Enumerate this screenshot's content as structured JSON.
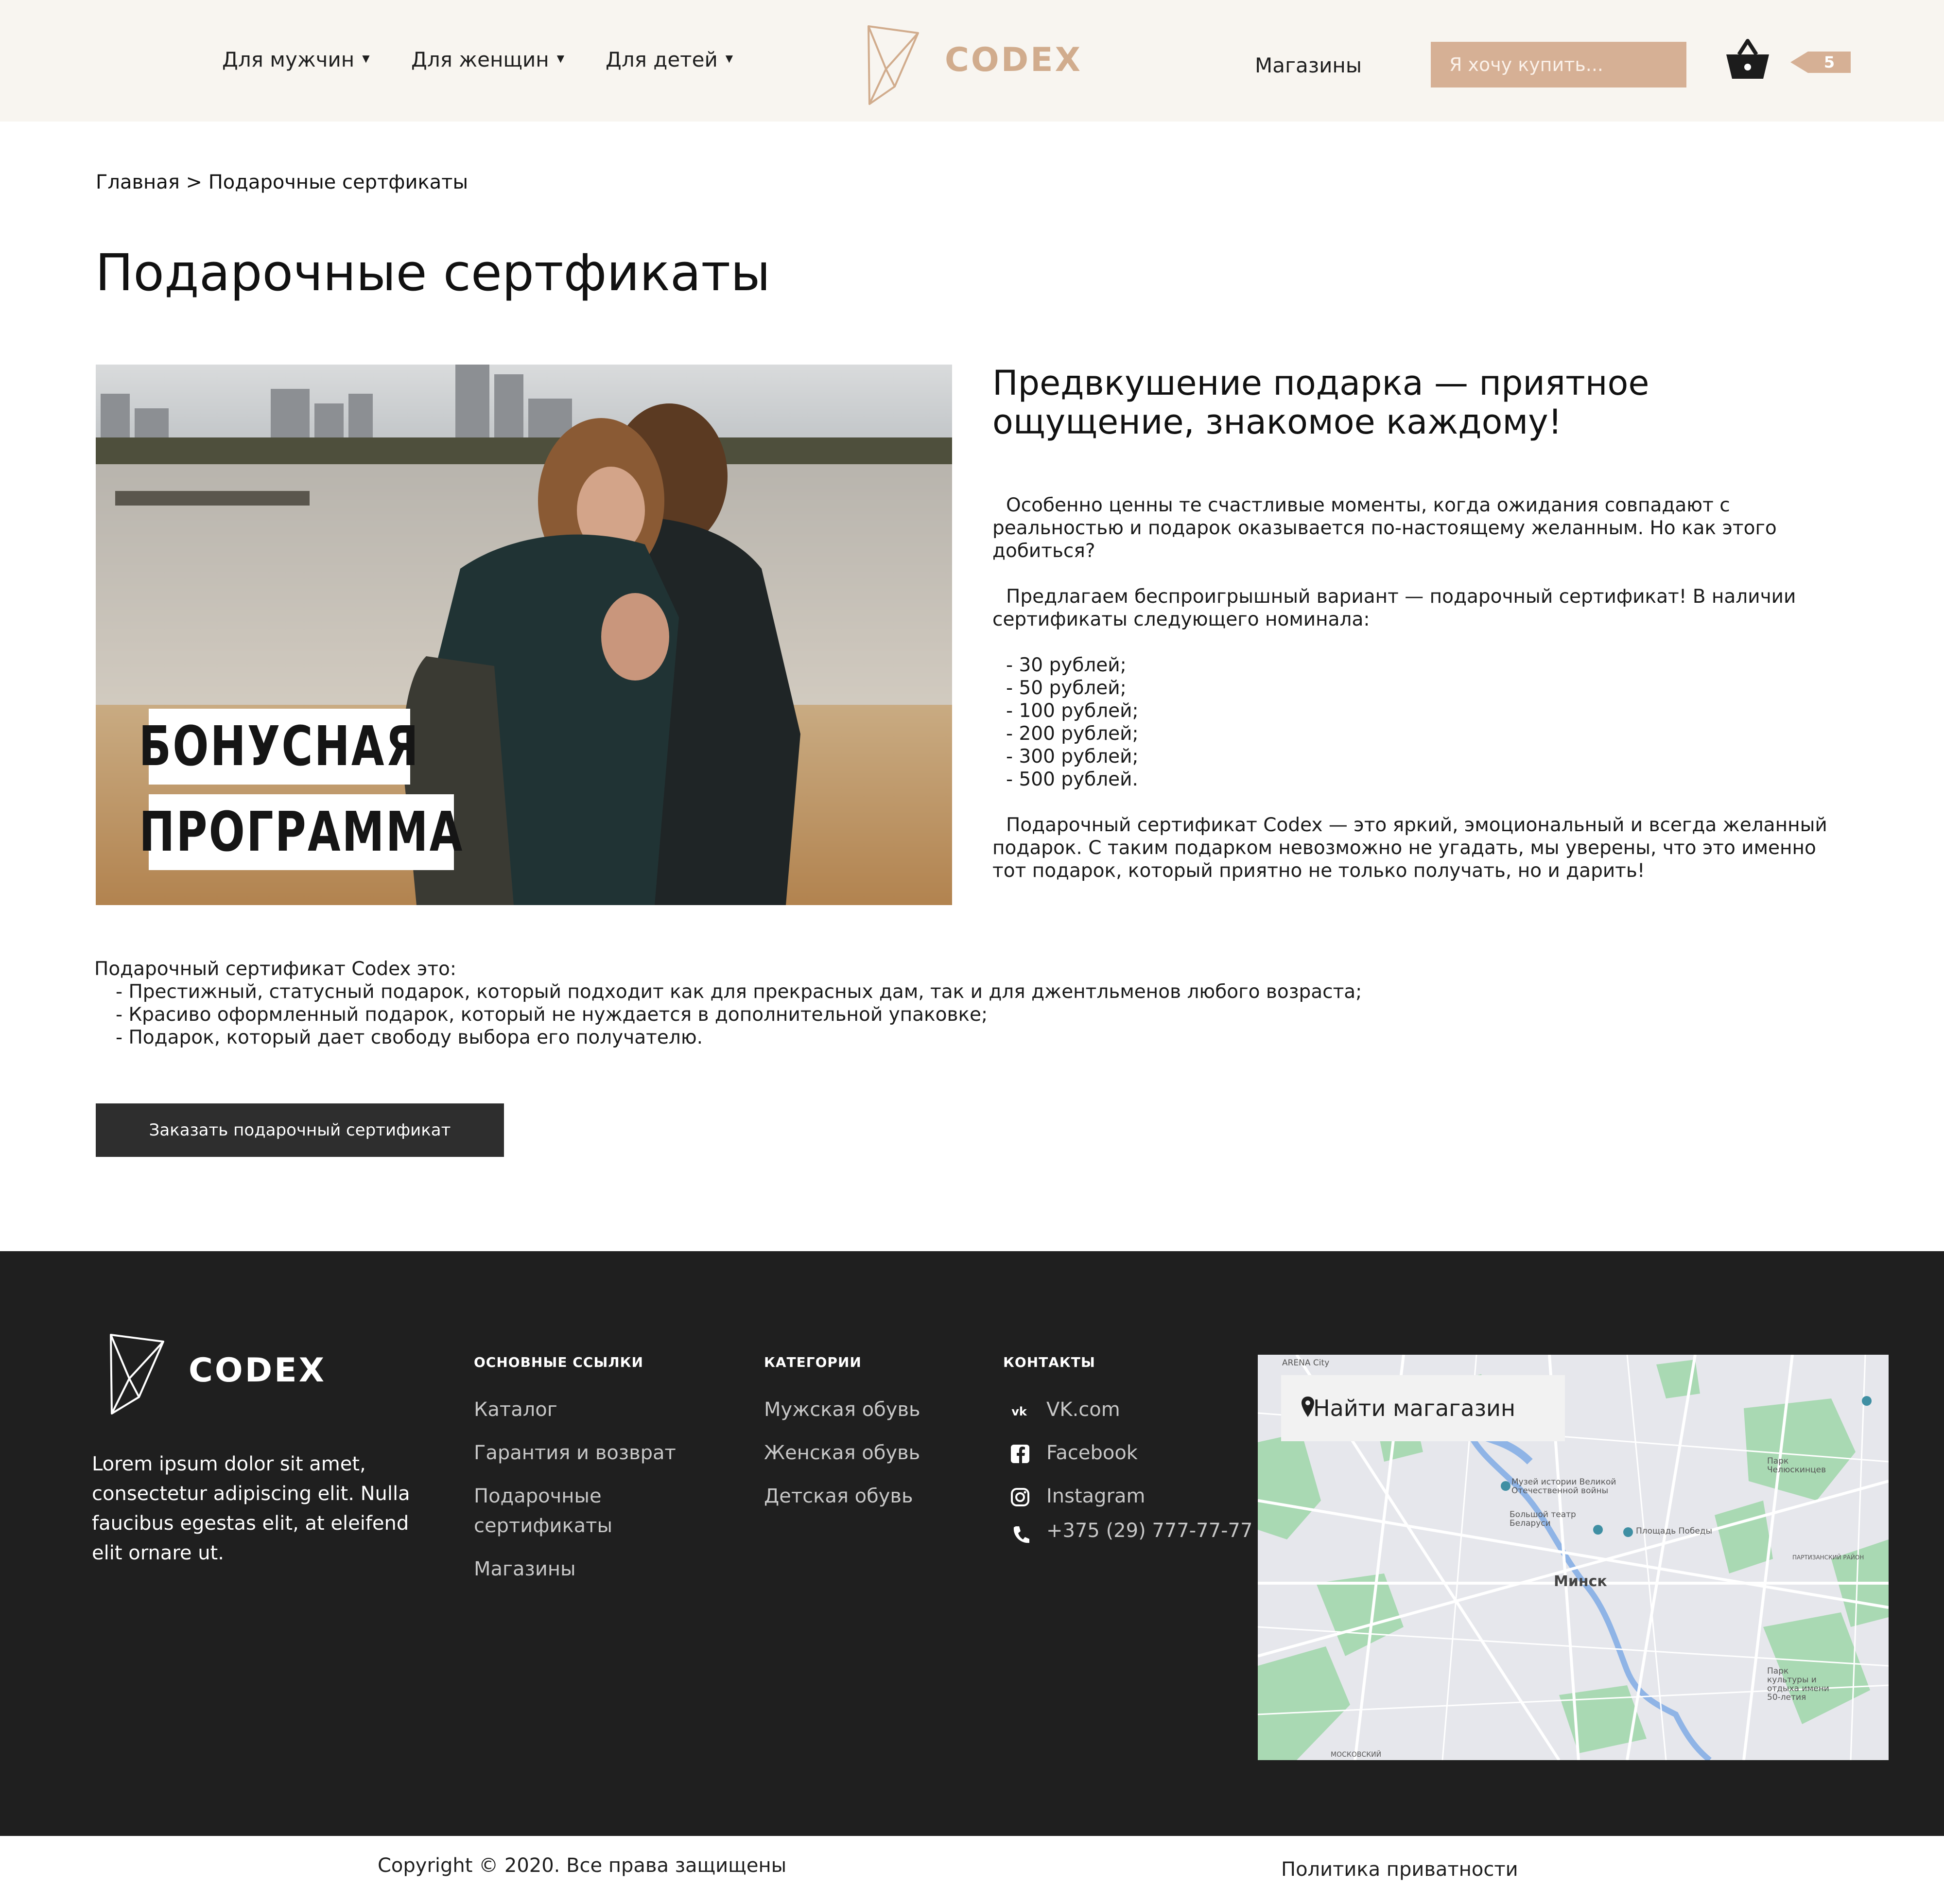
{
  "header": {
    "nav": [
      {
        "label": "Для мужчин"
      },
      {
        "label": "Для женщин"
      },
      {
        "label": "Для детей"
      }
    ],
    "logo_text": "CODEX",
    "stores_label": "Магазины",
    "search_placeholder": "Я хочу купить...",
    "cart_count": "5"
  },
  "breadcrumb": "Главная > Подарочные сертфикаты",
  "page_title": "Подарочные сертфикаты",
  "hero": {
    "promo_line1": "БОНУСНАЯ",
    "promo_line2": "ПРОГРАММА"
  },
  "intro": {
    "heading": "Предвкушение подарка — приятное ощущение, знакомое каждому!",
    "paragraph1": "Особенно ценны те счастливые моменты, когда ожидания совпадают с реальностью и подарок оказывается по-настоящему желанным. Но как этого добиться?",
    "paragraph2": "Предлагаем беспроигрышный вариант — подарочный сертификат! В наличии сертификаты следующего номинала:",
    "denominations": [
      "- 30 рублей;",
      "- 50 рублей;",
      "- 100 рублей;",
      "- 200 рублей;",
      "- 300 рублей;",
      "- 500 рублей."
    ],
    "paragraph3": "Подарочный сертификат Codex — это яркий, эмоциональный и всегда желанный подарок. С таким подарком невозможно не угадать, мы уверены, что это именно тот подарок, который приятно не только получать, но и дарить!"
  },
  "benefits": {
    "title": "Подарочный сертификат Codex это:",
    "items": [
      "- Престижный, статусный подарок, который подходит как для прекрасных дам, так и для джентльменов любого возраста;",
      "- Красиво оформленный подарок, который не нуждается в дополнительной упаковке;",
      "- Подарок, который дает свободу выбора его получателю."
    ]
  },
  "order_button": "Заказать подарочный сертификат",
  "footer": {
    "logo_text": "CODEX",
    "about": "Lorem ipsum dolor sit amet, consectetur adipiscing elit. Nulla faucibus egestas elit, at eleifend elit ornare ut.",
    "links_title": "ОСНОВНЫЕ ССЫЛКИ",
    "links": [
      "Каталог",
      "Гарантия и возврат",
      "Подарочные сертификаты",
      "Магазины"
    ],
    "categories_title": "КАТЕГОРИИ",
    "categories": [
      "Мужская обувь",
      "Женская обувь",
      "Детская обувь"
    ],
    "contacts_title": "КОНТАКТЫ",
    "contacts": [
      {
        "icon": "vk-icon",
        "label": "VK.com"
      },
      {
        "icon": "facebook-icon",
        "label": "Facebook"
      },
      {
        "icon": "instagram-icon",
        "label": "Instagram"
      },
      {
        "icon": "phone-icon",
        "label": "+375 (29) 777-77-77"
      }
    ],
    "map": {
      "search_label": "Найти магагазин",
      "city": "Минск",
      "labels": {
        "arena": "ARENA City",
        "museum": "Музей истории Великой Отечественной войны",
        "theatre": "Большой театр Беларуси",
        "square": "Площадь Победы",
        "park1": "Парк Челюскинцев",
        "partizan": "ПАРТИЗАНСКИЙ РАЙОН",
        "park2": "Парк культуры и отдыха имени 50-летия",
        "moskovsky": "МОСКОВСКИЙ"
      }
    }
  },
  "bottom": {
    "copyright": "Copyright © 2020. Все права защищены",
    "privacy": "Политика приватности"
  },
  "colors": {
    "header_bg": "#f8f5f0",
    "accent": "#d1ac8d",
    "search_bg": "#d6b095",
    "footer_bg": "#1f1f1f",
    "button_bg": "#2e2e2e"
  }
}
